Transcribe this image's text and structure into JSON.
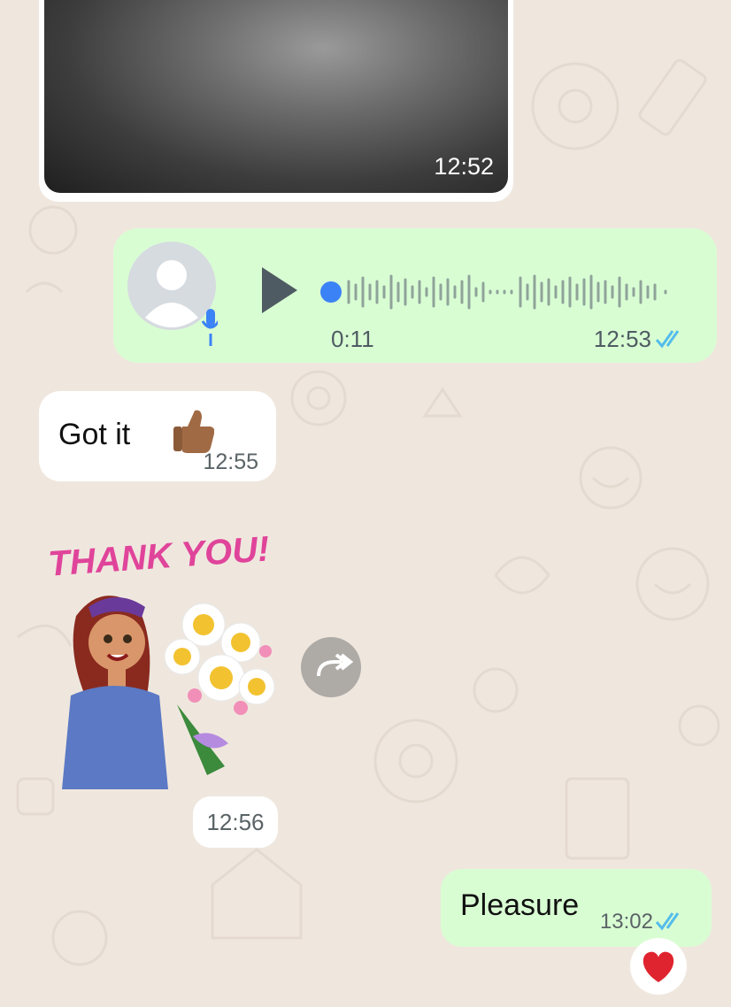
{
  "messages": {
    "image": {
      "time": "12:52"
    },
    "voice": {
      "duration": "0:11",
      "time": "12:53",
      "status": "read"
    },
    "got_it": {
      "text": "Got it",
      "emoji": "thumbs-up",
      "time": "12:55"
    },
    "sticker": {
      "caption_art": "THANK YOU!",
      "time": "12:56"
    },
    "pleasure": {
      "text": "Pleasure",
      "time": "13:02",
      "status": "read",
      "reaction": "red-heart"
    }
  },
  "colors": {
    "outgoing_bubble": "#d9fdd3",
    "incoming_bubble": "#ffffff",
    "chat_background": "#efe7de",
    "read_ticks": "#53bdeb",
    "voice_progress": "#3b82f6"
  }
}
